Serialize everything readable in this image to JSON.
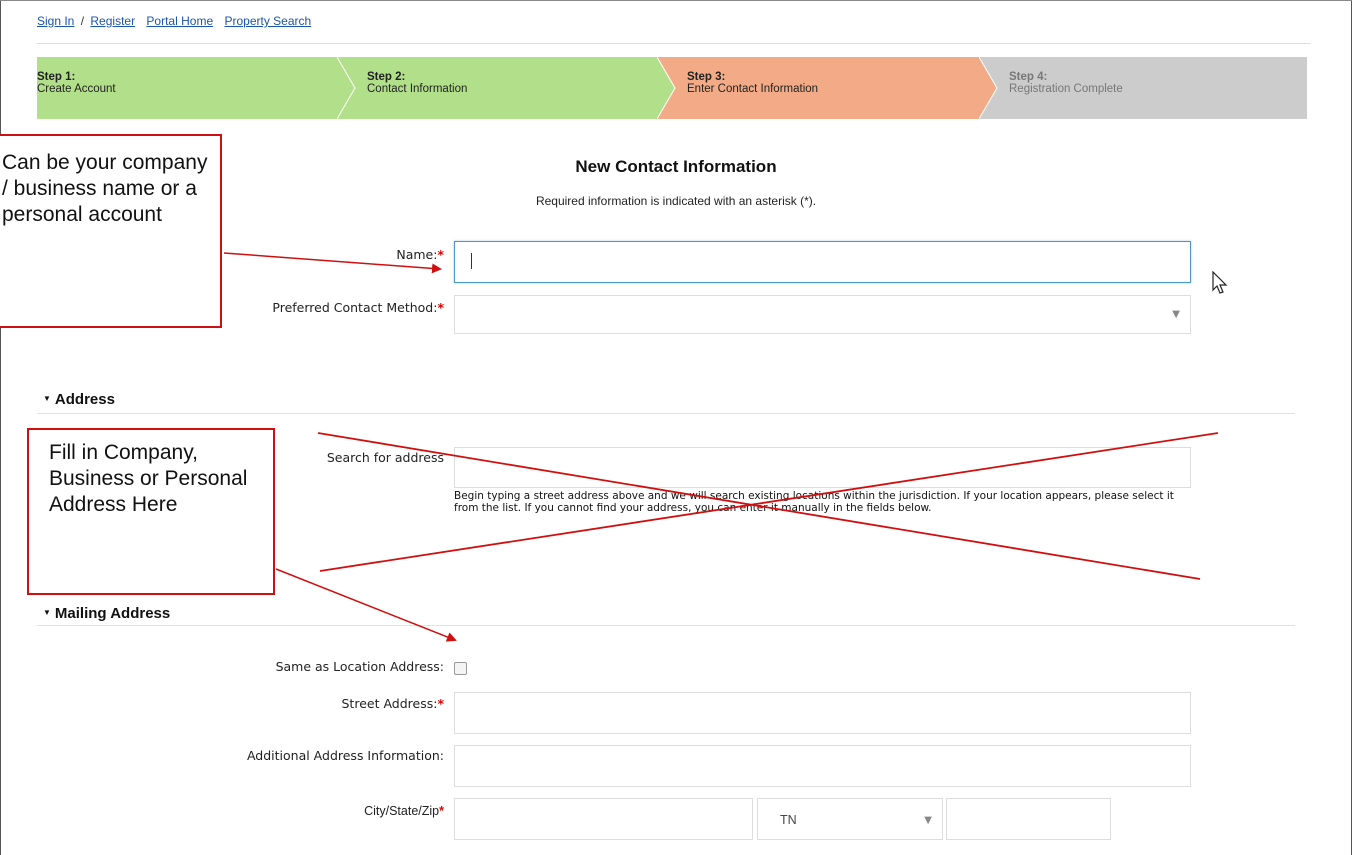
{
  "nav": {
    "sign_in": "Sign In",
    "separator": "/",
    "register": "Register",
    "portal_home": "Portal Home",
    "property_search": "Property Search"
  },
  "steps": [
    {
      "num": "Step 1:",
      "label": "Create Account",
      "color": "#b2df8a",
      "state": "complete"
    },
    {
      "num": "Step 2:",
      "label": "Contact Information",
      "color": "#b2df8a",
      "state": "complete"
    },
    {
      "num": "Step 3:",
      "label": "Enter Contact Information",
      "color": "#f2ab86",
      "state": "current"
    },
    {
      "num": "Step 4:",
      "label": "Registration Complete",
      "color": "#cccccc",
      "state": "pending"
    }
  ],
  "page": {
    "title": "New Contact Information",
    "subtitle": "Required information is indicated with an asterisk (*)."
  },
  "form": {
    "name_label": "Name:",
    "name_value": "",
    "contact_method_label": "Preferred Contact Method:",
    "contact_method_value": "",
    "required_marker": "*"
  },
  "address": {
    "heading": "Address",
    "search_label": "Search for address",
    "search_value": "",
    "help": "Begin typing a street address above and we will search existing locations within the jurisdiction. If your location appears, please select it from the list. If you cannot find your address, you can enter it manually in the fields below."
  },
  "mailing": {
    "heading": "Mailing Address",
    "same_label": "Same as Location Address:",
    "same_checked": false,
    "street_label": "Street Address:",
    "additional_label": "Additional Address Information:",
    "city_label": "City/State/Zip",
    "state_value": "TN"
  },
  "annotations": {
    "callout1": "Can be your company / business name or a personal account",
    "callout2": "Fill in Company, Business or Personal Address Here",
    "annotation_color": "#d01010"
  },
  "icons": {
    "dropdown": "chevron-down-icon",
    "section_toggle": "triangle-down-icon",
    "cursor": "mouse-pointer-icon"
  }
}
